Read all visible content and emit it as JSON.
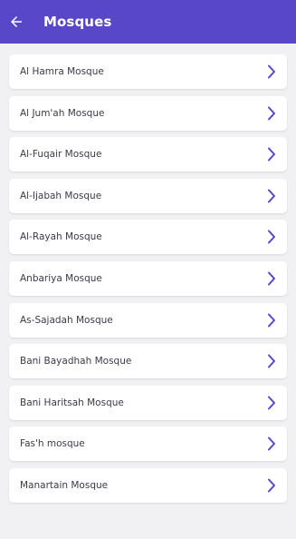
{
  "header": {
    "title": "Mosques",
    "back_icon": "arrow-left-icon",
    "background": "#5848c9"
  },
  "list": {
    "items": [
      {
        "label": "Al Hamra Mosque"
      },
      {
        "label": "Al Jum'ah Mosque"
      },
      {
        "label": "Al-Fuqair Mosque"
      },
      {
        "label": "Al-Ijabah Mosque"
      },
      {
        "label": "Al-Rayah Mosque"
      },
      {
        "label": "Anbariya Mosque"
      },
      {
        "label": "As-Sajadah Mosque"
      },
      {
        "label": "Bani Bayadhah Mosque"
      },
      {
        "label": "Bani Haritsah Mosque"
      },
      {
        "label": "Fas'h mosque"
      },
      {
        "label": "Manartain Mosque"
      }
    ],
    "chevron_icon": "chevron-right-icon",
    "chevron_color": "#5848c9"
  }
}
